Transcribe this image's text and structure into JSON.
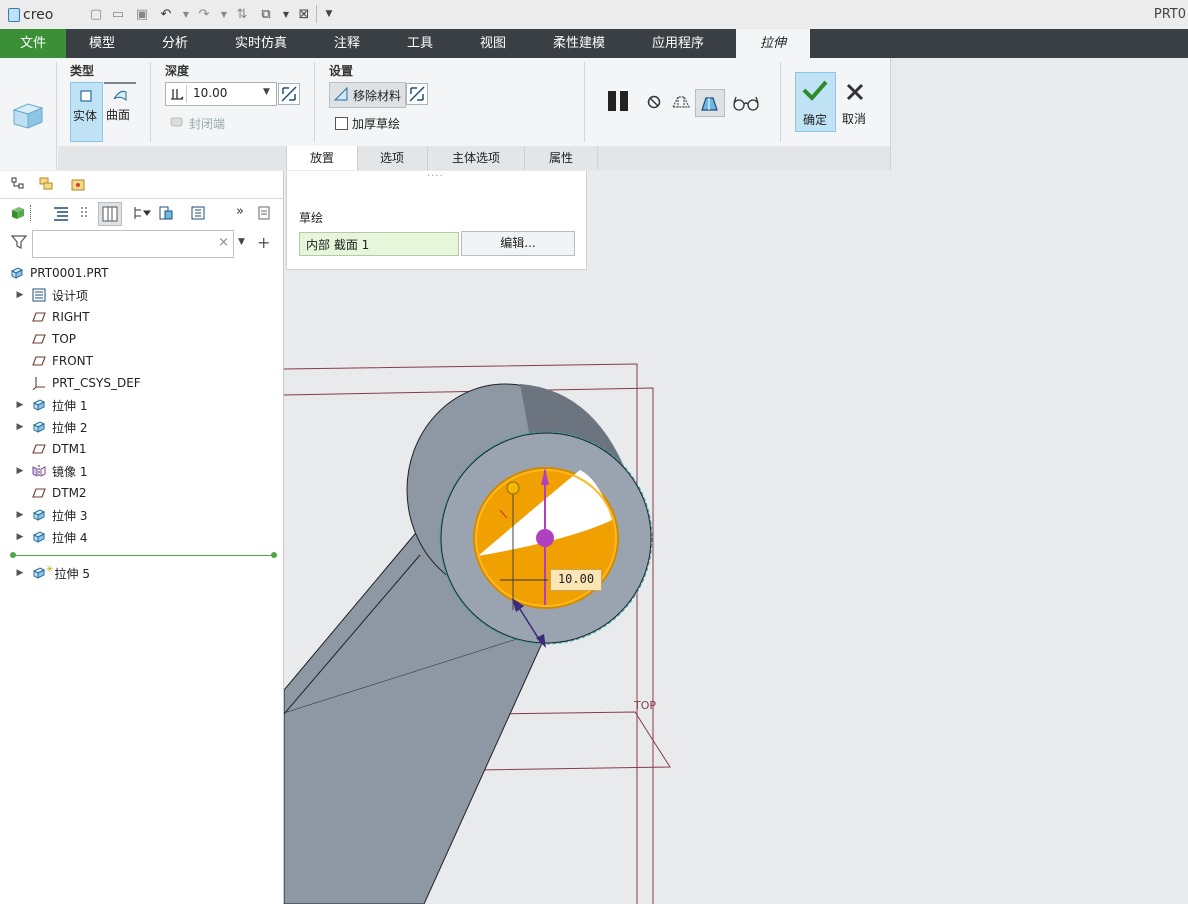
{
  "app": {
    "logo_text": "creo",
    "window_title": "PRT0"
  },
  "ribbon_tabs": [
    "文件",
    "模型",
    "分析",
    "实时仿真",
    "注释",
    "工具",
    "视图",
    "柔性建模",
    "应用程序",
    "拉伸"
  ],
  "ribbon": {
    "type_label": "类型",
    "solid_label": "实体",
    "surface_label": "曲面",
    "depth_label": "深度",
    "depth_value": "10.00",
    "cap_ends_label": "封闭端",
    "settings_label": "设置",
    "remove_material_label": "移除材料",
    "thicken_label": "加厚草绘",
    "ok_label": "确定",
    "cancel_label": "取消"
  },
  "ribbon_bottom_tabs": [
    "放置",
    "选项",
    "主体选项",
    "属性"
  ],
  "panel": {
    "sketch_label": "草绘",
    "sketch_value": "内部 截面 1",
    "edit_button": "编辑..."
  },
  "tree": {
    "search_placeholder": "",
    "root": "PRT0001.PRT",
    "items": [
      {
        "label": "设计项",
        "icon": "design-items-icon",
        "expandable": true
      },
      {
        "label": "RIGHT",
        "icon": "datum-plane-icon",
        "expandable": false
      },
      {
        "label": "TOP",
        "icon": "datum-plane-icon",
        "expandable": false
      },
      {
        "label": "FRONT",
        "icon": "datum-plane-icon",
        "expandable": false
      },
      {
        "label": "PRT_CSYS_DEF",
        "icon": "csys-icon",
        "expandable": false
      },
      {
        "label": "拉伸 1",
        "icon": "extrude-icon",
        "expandable": true
      },
      {
        "label": "拉伸 2",
        "icon": "extrude-icon",
        "expandable": true
      },
      {
        "label": "DTM1",
        "icon": "datum-plane-icon",
        "expandable": false
      },
      {
        "label": "镜像 1",
        "icon": "mirror-icon",
        "expandable": true
      },
      {
        "label": "DTM2",
        "icon": "datum-plane-icon",
        "expandable": false
      },
      {
        "label": "拉伸 3",
        "icon": "extrude-icon",
        "expandable": true
      },
      {
        "label": "拉伸 4",
        "icon": "extrude-icon",
        "expandable": true
      }
    ],
    "active_item": {
      "label": "拉伸 5",
      "icon": "extrude-new-icon"
    }
  },
  "viewport": {
    "dimension_value": "10.00",
    "plane_label": "TOP"
  },
  "colors": {
    "file_tab": "#3b8f37",
    "tab_bar": "#3a3f44",
    "ribbon_bg": "#f4f5f6",
    "part_grey": "#8e97a4",
    "cut_orange": "#f0a000",
    "handle": "#b040c0",
    "datum": "#8a3a4a"
  }
}
